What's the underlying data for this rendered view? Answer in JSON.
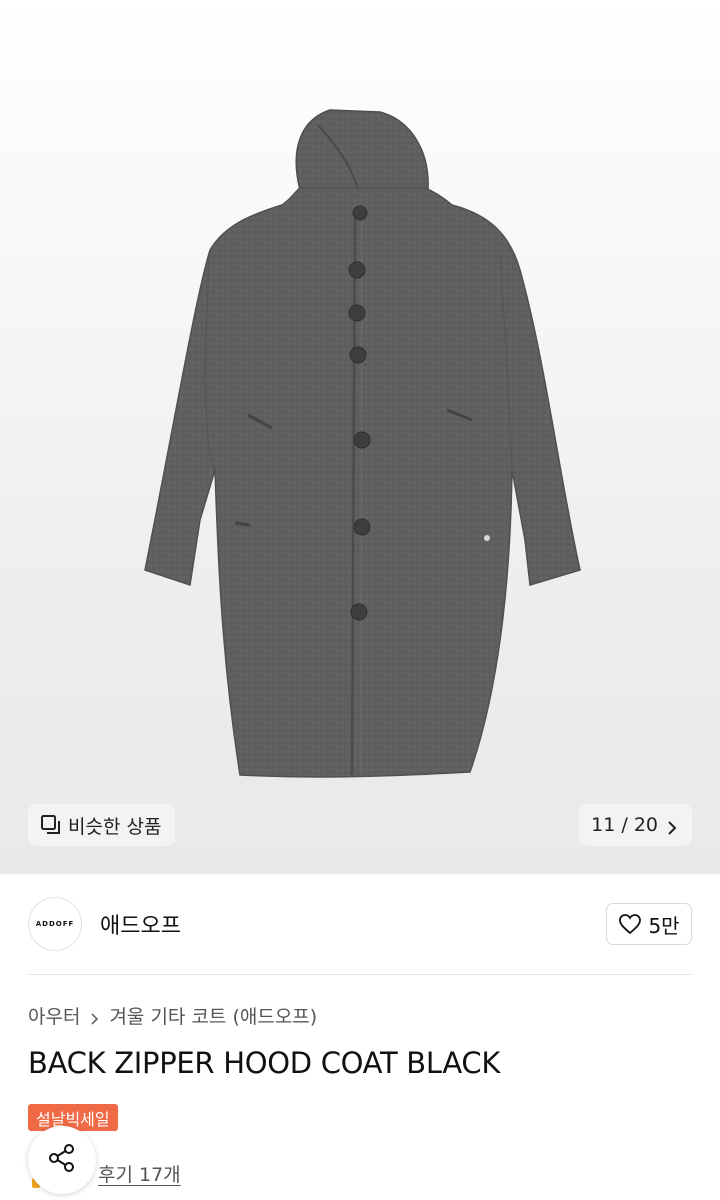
{
  "gallery": {
    "similar_label": "비슷한 상품",
    "counter": "11 / 20",
    "image_subject": "grey wool hooded coat"
  },
  "brand": {
    "logo_text": "ADDOFF",
    "name": "애드오프",
    "likes": "5만"
  },
  "breadcrumb": {
    "category": "아우터",
    "subcategory": "겨울 기타 코트 (애드오프)"
  },
  "product": {
    "title": "BACK ZIPPER HOOD COAT BLACK",
    "badge": "설날빅세일",
    "reviews": "후기 17개"
  },
  "colors": {
    "badge": "#f06a45",
    "coat": "#5e5e5e"
  },
  "icons": {
    "similar": "stacked-squares-icon",
    "next": "chevron-right-icon",
    "like": "heart-outline-icon",
    "share": "share-icon"
  }
}
